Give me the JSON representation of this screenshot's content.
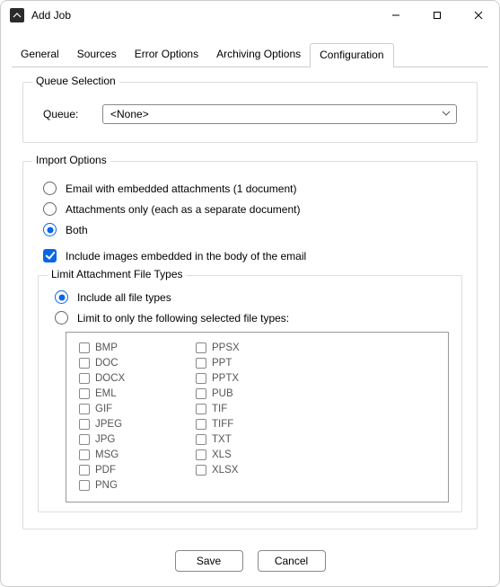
{
  "window": {
    "title": "Add Job"
  },
  "tabs": [
    {
      "label": "General",
      "active": false
    },
    {
      "label": "Sources",
      "active": false
    },
    {
      "label": "Error Options",
      "active": false
    },
    {
      "label": "Archiving Options",
      "active": false
    },
    {
      "label": "Configuration",
      "active": true
    }
  ],
  "queue_section": {
    "legend": "Queue Selection",
    "label": "Queue:",
    "value": "<None>"
  },
  "import_section": {
    "legend": "Import Options",
    "mode_options": [
      {
        "label": "Email with embedded attachments (1 document)",
        "selected": false
      },
      {
        "label": "Attachments only (each as a separate document)",
        "selected": false
      },
      {
        "label": "Both",
        "selected": true
      }
    ],
    "include_images": {
      "label": "Include images embedded in the body of the email",
      "checked": true
    },
    "limit_section": {
      "legend": "Limit Attachment File Types",
      "limit_options": [
        {
          "label": "Include all file types",
          "selected": true
        },
        {
          "label": "Limit to only the following selected file types:",
          "selected": false
        }
      ],
      "file_types_col1": [
        "BMP",
        "DOC",
        "DOCX",
        "EML",
        "GIF",
        "JPEG",
        "JPG",
        "MSG",
        "PDF",
        "PNG"
      ],
      "file_types_col2": [
        "PPSX",
        "PPT",
        "PPTX",
        "PUB",
        "TIF",
        "TIFF",
        "TXT",
        "XLS",
        "XLSX"
      ]
    }
  },
  "footer": {
    "save": "Save",
    "cancel": "Cancel"
  }
}
